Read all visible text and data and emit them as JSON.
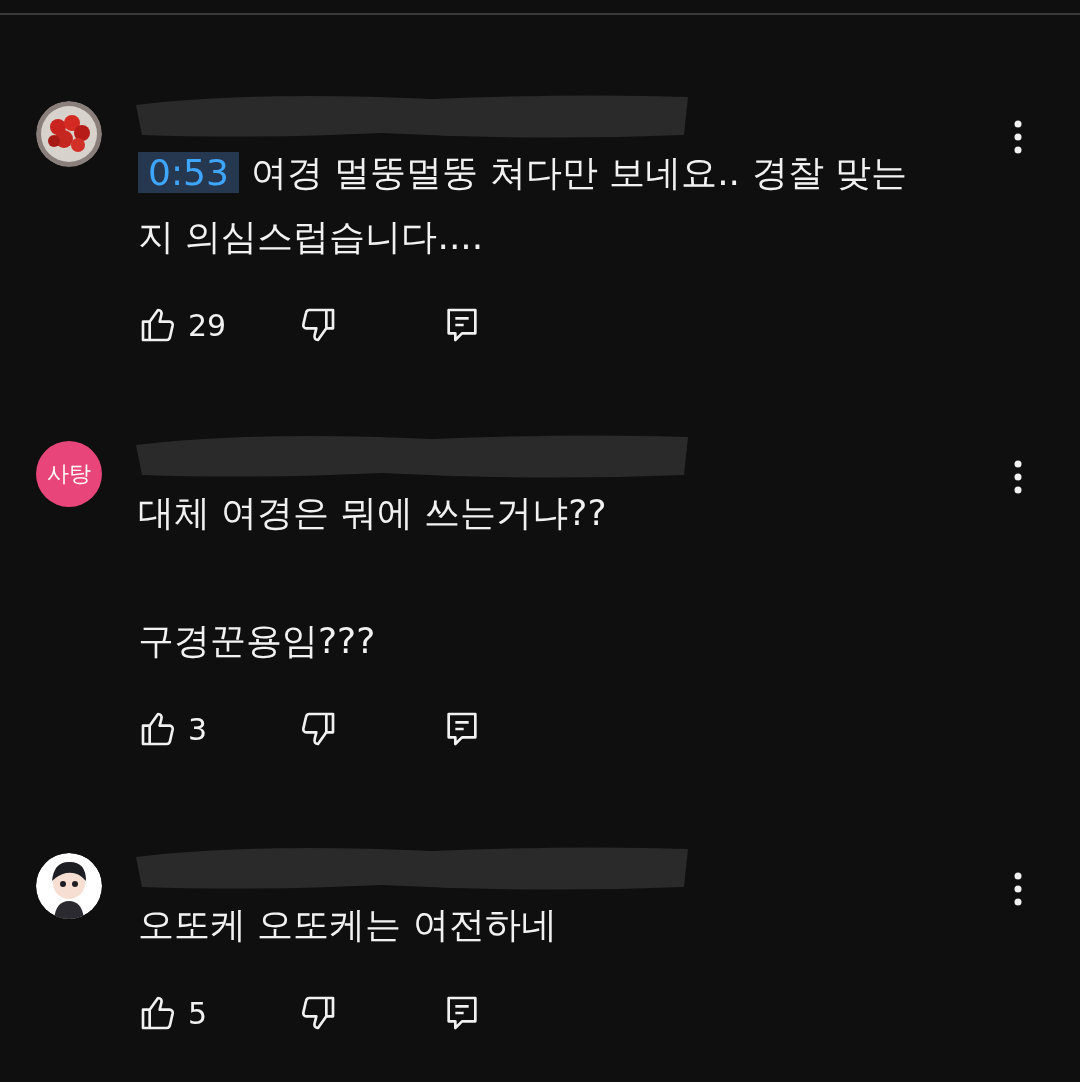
{
  "comments": [
    {
      "avatar": {
        "kind": "picture"
      },
      "timestamp": "0:53",
      "paragraphs": [
        [
          "여경 멀뚱멀뚱 쳐다만 보네요.. 경찰 맞는",
          "지 의심스럽습니다...."
        ]
      ],
      "likes": "29"
    },
    {
      "avatar": {
        "kind": "text",
        "text": "사탕",
        "color": "#e8457a"
      },
      "paragraphs": [
        [
          "대체 여경은 뭐에 쓰는거냐??"
        ],
        [
          "구경꾼용임???"
        ]
      ],
      "likes": "3"
    },
    {
      "avatar": {
        "kind": "illustration"
      },
      "paragraphs": [
        [
          "오또케 오또케는 여전하네"
        ]
      ],
      "likes": "5"
    }
  ]
}
